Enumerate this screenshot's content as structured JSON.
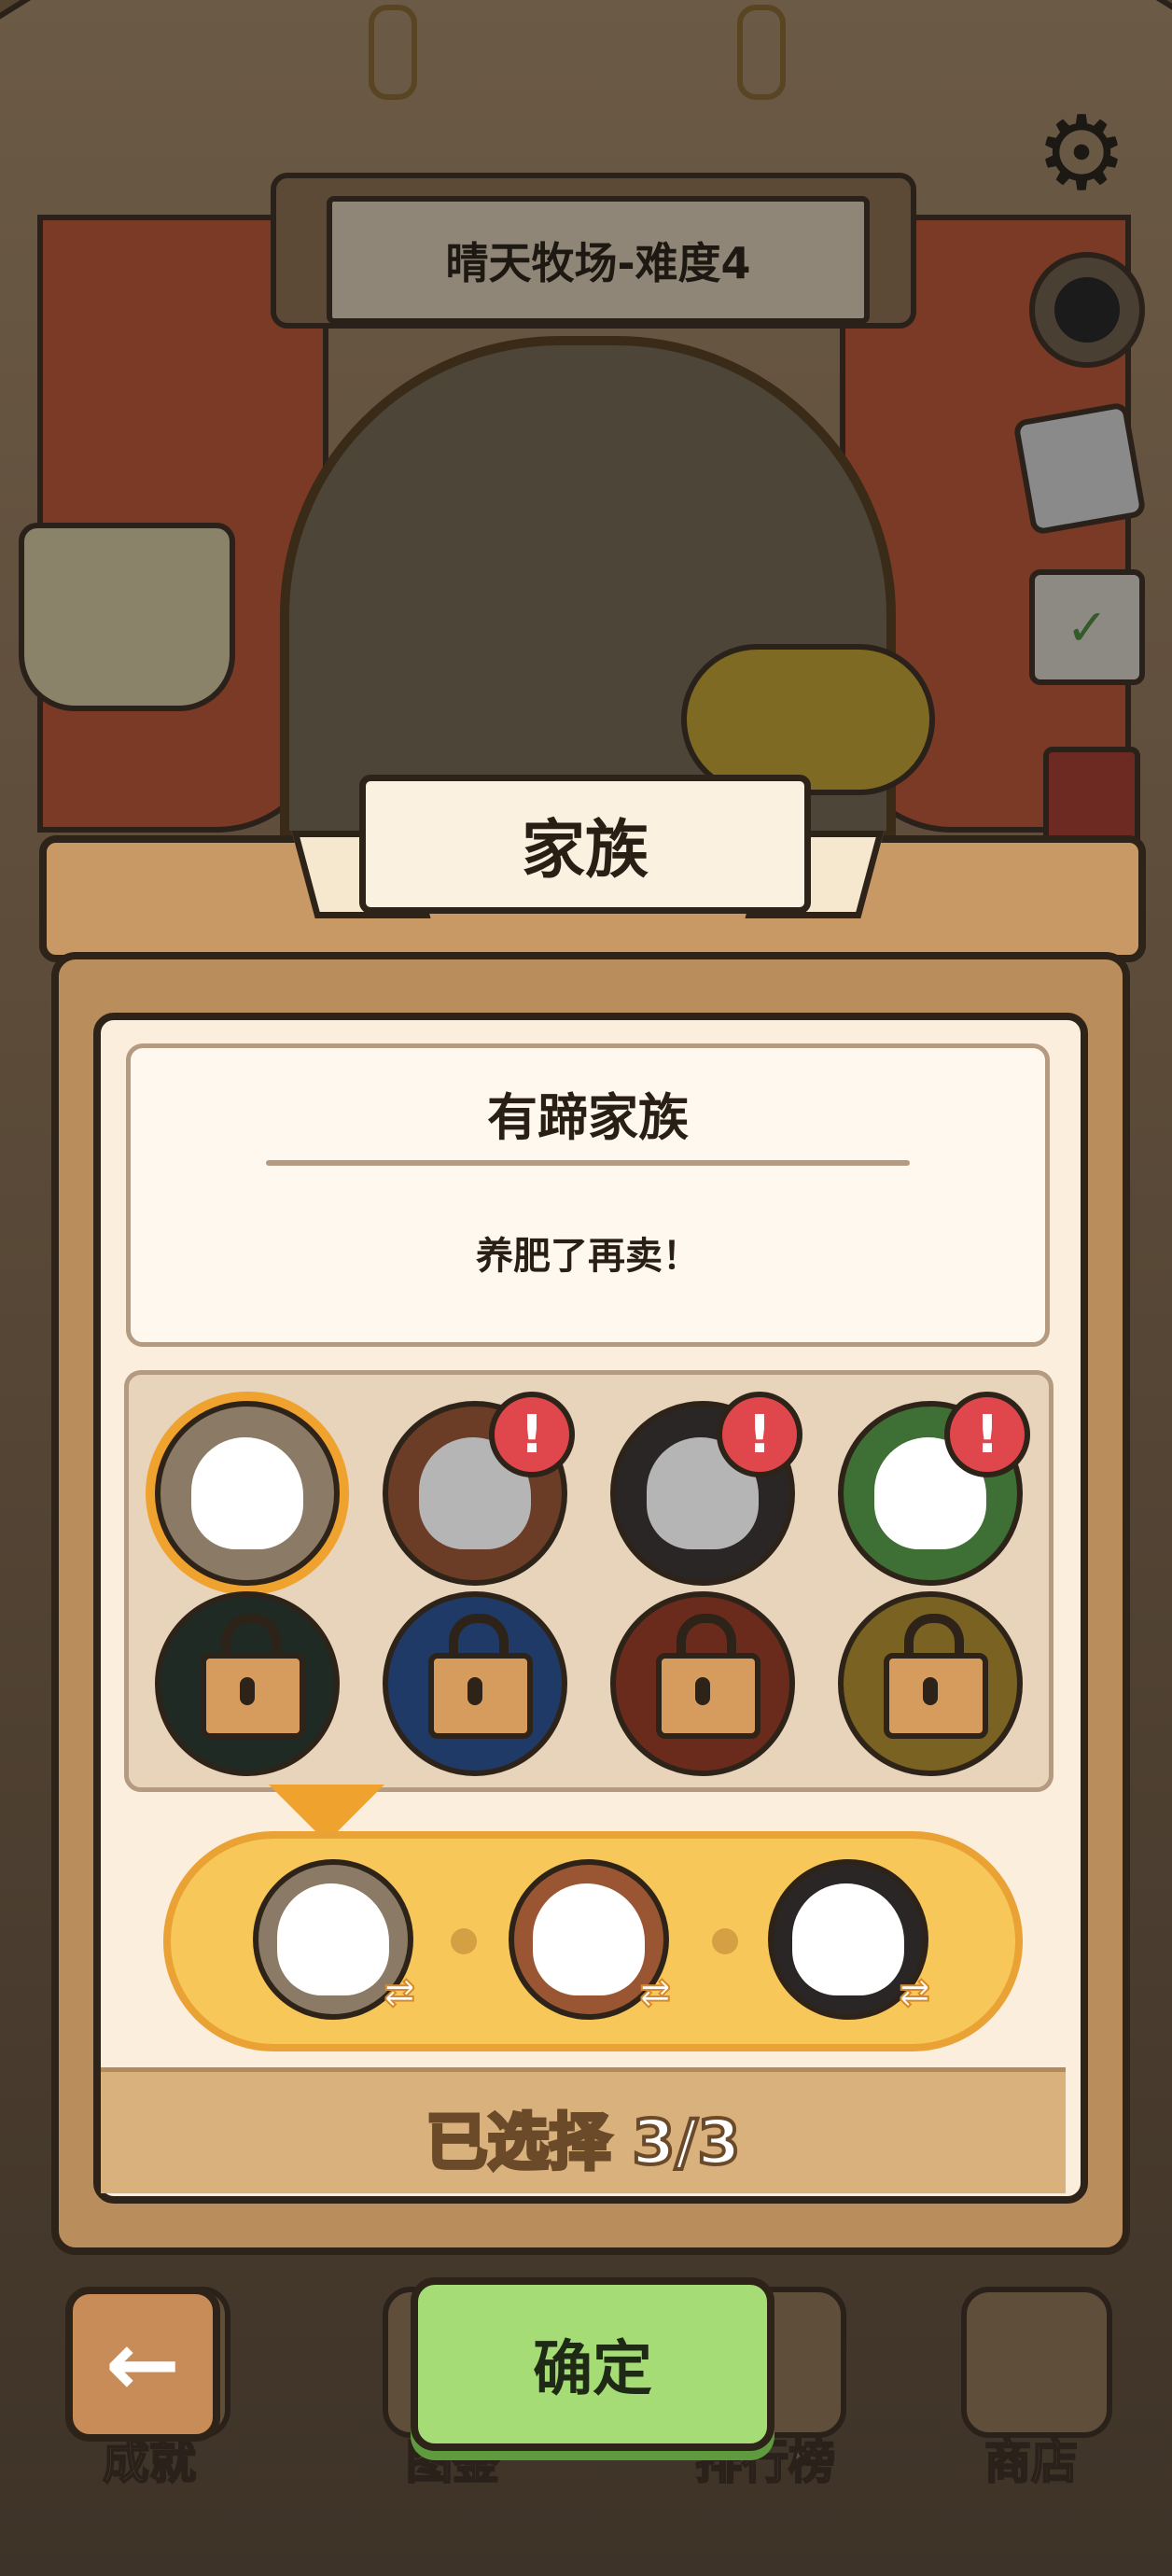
{
  "header": {
    "level_title": "晴天牧场-难度4"
  },
  "modal": {
    "title": "家族",
    "family_name": "有蹄家族",
    "family_description": "养肥了再卖！",
    "selected_count_text": "已选择 3/3",
    "confirm_label": "确定"
  },
  "families": [
    {
      "name": "hoofed",
      "color": "#8b7a66",
      "state": "selected",
      "alert": false
    },
    {
      "name": "bird",
      "color": "#6b3d27",
      "state": "unlocked",
      "alert": true,
      "alert_text": "!"
    },
    {
      "name": "predator",
      "color": "#2a2626",
      "state": "unlocked",
      "alert": true,
      "alert_text": "!"
    },
    {
      "name": "amphibian",
      "color": "#3e6f34",
      "state": "unlocked",
      "alert": true,
      "alert_text": "!"
    },
    {
      "name": "locked-1",
      "color": "#1f2a24",
      "state": "locked",
      "alert": false
    },
    {
      "name": "locked-2",
      "color": "#1f3a66",
      "state": "locked",
      "alert": false
    },
    {
      "name": "locked-3",
      "color": "#6a2b1c",
      "state": "locked",
      "alert": false
    },
    {
      "name": "locked-4",
      "color": "#7a6222",
      "state": "locked",
      "alert": false
    }
  ],
  "team": [
    {
      "name": "hoofed",
      "color": "#8b7a66"
    },
    {
      "name": "bird",
      "color": "#9a5632"
    },
    {
      "name": "predator",
      "color": "#2a2626"
    }
  ],
  "nav": [
    {
      "label": "成就"
    },
    {
      "label": "图鉴"
    },
    {
      "label": "排行榜"
    },
    {
      "label": "商店"
    }
  ],
  "icons": {
    "settings": "gear-icon",
    "avatar": "penguin-avatar-icon",
    "announcement": "megaphone-icon",
    "calendar": "calendar-check-icon",
    "red_packet": "red-packet-icon",
    "back": "back-arrow-icon",
    "swap": "swap-icon",
    "lock": "lock-icon"
  },
  "colors": {
    "accent_orange": "#f0a22e",
    "confirm_green": "#a5dc76",
    "alert_red": "#e0474d",
    "panel_cream": "#fbeedd",
    "panel_wood": "#b98e5c"
  }
}
